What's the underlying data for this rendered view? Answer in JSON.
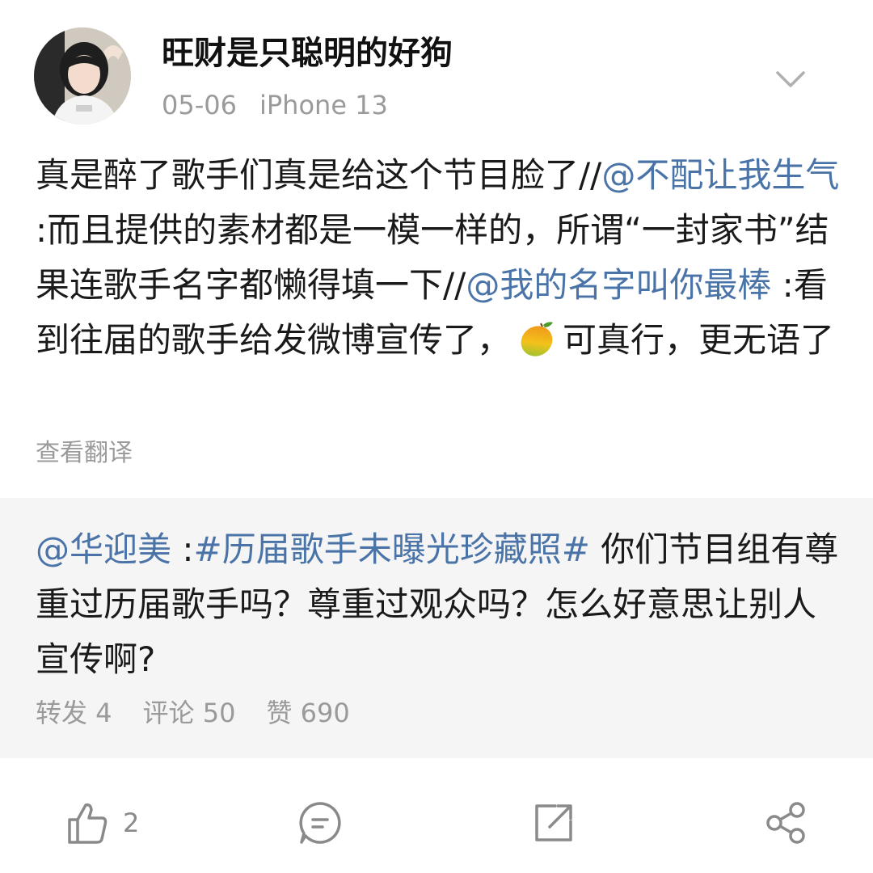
{
  "header": {
    "username": "旺财是只聪明的好狗",
    "date": "05-06",
    "device": "iPhone 13"
  },
  "post": {
    "t1": "真是醉了歌手们真是给这个节目脸了//",
    "m1": "@不配让我生气",
    "t2": " :而且提供的素材都是一模一样的，所谓“一封家书”结果连歌手名字都懒得填一下//",
    "m2": "@我的名字叫你最棒",
    "t3": " :看到往届的歌手给发微博宣传了，",
    "emoji": "mango-emoji",
    "t4": "可真行，更无语了"
  },
  "translate_label": "查看翻译",
  "quote": {
    "mention": "@华迎美",
    "sep": " :",
    "topic": "#历届歌手未曝光珍藏照#",
    "text": " 你们节目组有尊重过历届歌手吗？尊重过观众吗？怎么好意思让别人宣传啊?",
    "stats": {
      "repost": "转发 4",
      "comment": "评论 50",
      "like": "赞 690"
    }
  },
  "actions": {
    "like_count": "2",
    "icons": [
      "thumbs-up-icon",
      "comment-icon",
      "repost-icon",
      "share-icon"
    ]
  },
  "colors": {
    "link": "#4a74a8",
    "muted": "#9a9a9a",
    "quote_bg": "#f5f5f5"
  }
}
